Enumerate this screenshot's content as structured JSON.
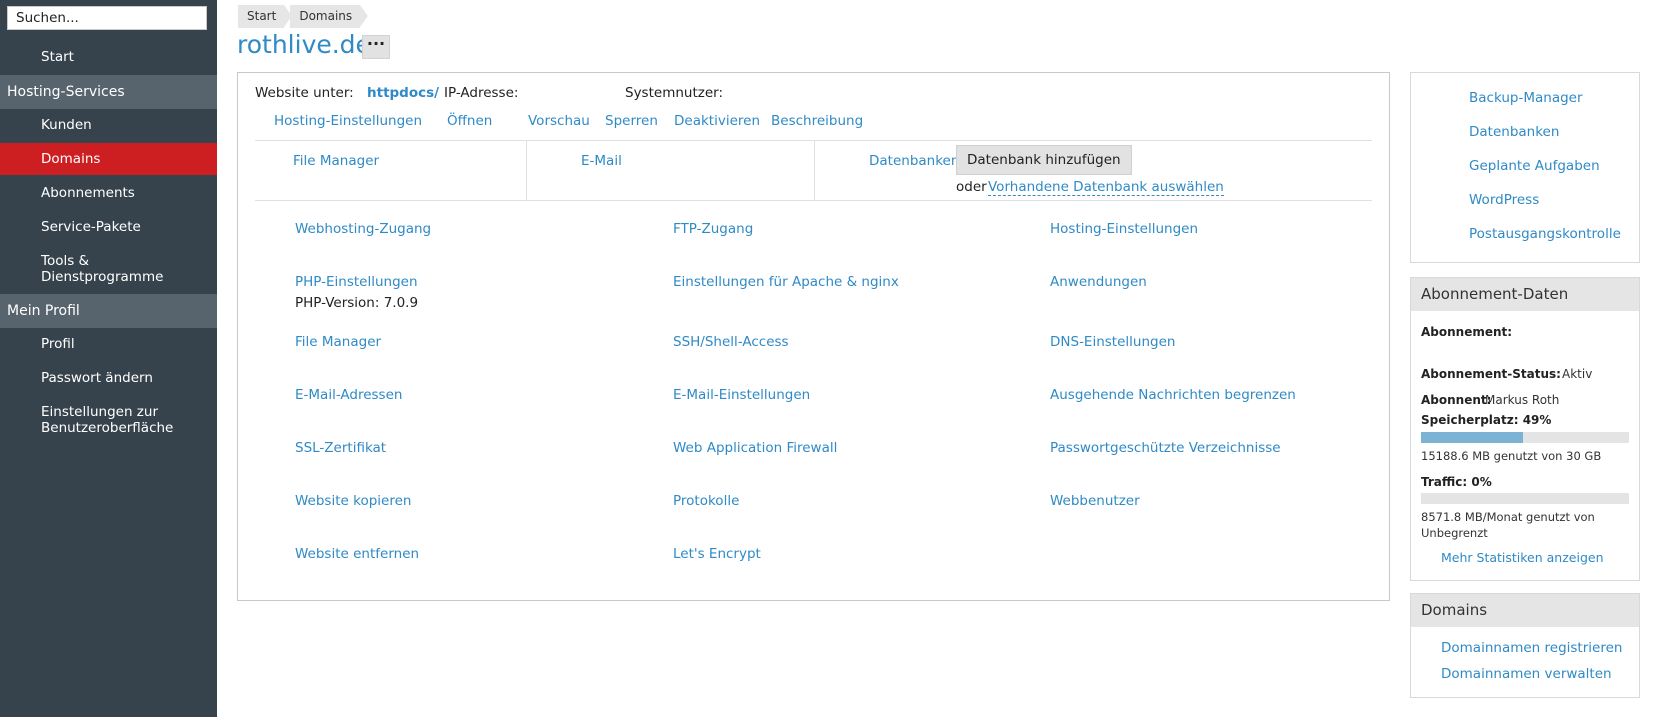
{
  "sidebar": {
    "search_placeholder": "Suchen...",
    "start": "Start",
    "group_hosting": "Hosting-Services",
    "kunden": "Kunden",
    "domains": "Domains",
    "abonnements": "Abonnements",
    "service_pakete": "Service-Pakete",
    "tools_line1": "Tools &",
    "tools_line2": "Dienstprogramme",
    "group_profil": "Mein Profil",
    "profil": "Profil",
    "passwort": "Passwort ändern",
    "einstellungen_line1": "Einstellungen zur",
    "einstellungen_line2": "Benutzeroberfläche"
  },
  "breadcrumb": [
    "Start",
    "Domains"
  ],
  "page": {
    "title": "rothlive.de",
    "more_label": "···"
  },
  "main": {
    "website_label": "Website unter:",
    "website_path": "httpdocs/",
    "ip_label": "IP-Adresse:",
    "sysuser_label": "Systemnutzer:",
    "actions": [
      "Hosting-Einstellungen",
      "Öffnen",
      "Vorschau",
      "Sperren",
      "Deaktivieren",
      "Beschreibung"
    ],
    "file_manager": "File Manager",
    "email": "E-Mail",
    "datenbanken": "Datenbanken",
    "db_add": "Datenbank hinzufügen",
    "db_or": "oder",
    "db_existing": "Vorhandene Datenbank auswählen",
    "grid": {
      "col1": [
        "Webhosting-Zugang",
        "PHP-Einstellungen",
        "File Manager",
        "E-Mail-Adressen",
        "SSL-Zertifikat",
        "Website kopieren",
        "Website entfernen"
      ],
      "php_version": "PHP-Version: 7.0.9",
      "col2": [
        "FTP-Zugang",
        "Einstellungen für Apache & nginx",
        "SSH/Shell-Access",
        "E-Mail-Einstellungen",
        "Web Application Firewall",
        "Protokolle",
        "Let's Encrypt"
      ],
      "col3": [
        "Hosting-Einstellungen",
        "Anwendungen",
        "DNS-Einstellungen",
        "Ausgehende Nachrichten begrenzen",
        "Passwortgeschützte Verzeichnisse",
        "Webbenutzer"
      ]
    }
  },
  "right": {
    "links": [
      "Backup-Manager",
      "Datenbanken",
      "Geplante Aufgaben",
      "WordPress",
      "Postausgangskontrolle"
    ],
    "abo": {
      "title": "Abonnement-Daten",
      "abonnement_label": "Abonnement:",
      "status_label": "Abonnement-Status:",
      "status_value": "Aktiv",
      "abonnent_label": "Abonnent:",
      "abonnent_value": "Markus Roth",
      "speicher_label": "Speicherplatz: 49%",
      "speicher_percent": 49,
      "speicher_text": "15188.6 MB genutzt von 30 GB",
      "traffic_label": "Traffic: 0%",
      "traffic_percent": 0,
      "traffic_text_line1": "8571.8 MB/Monat genutzt von",
      "traffic_text_line2": "Unbegrenzt",
      "more_stats": "Mehr Statistiken anzeigen"
    },
    "domains": {
      "title": "Domains",
      "register": "Domainnamen registrieren",
      "manage": "Domainnamen verwalten"
    }
  },
  "colors": {
    "sidebar_bg": "#37434c",
    "sidebar_group_bg": "#57646d",
    "active_red": "#cd1f22",
    "link_blue": "#2f8ac6",
    "progress_fill": "#7ab3d4"
  }
}
